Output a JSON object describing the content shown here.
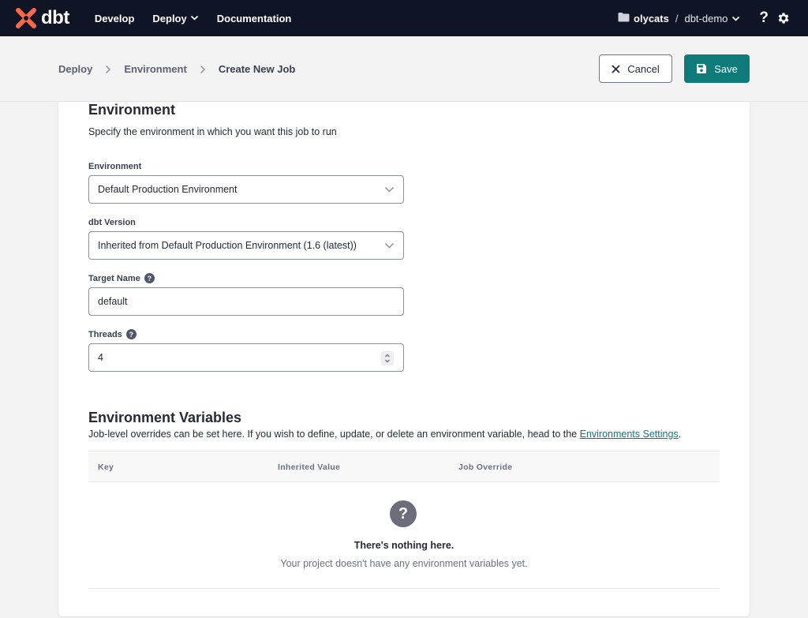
{
  "nav": {
    "logo_text": "dbt",
    "items": [
      {
        "label": "Develop"
      },
      {
        "label": "Deploy"
      },
      {
        "label": "Documentation"
      }
    ],
    "account": {
      "org": "olycats",
      "separator": "/",
      "project": "dbt-demo"
    },
    "help_label": "?",
    "brand_color": "#ff694a",
    "nav_bg": "#0f1525"
  },
  "breadcrumb": {
    "items": [
      "Deploy",
      "Environment",
      "Create New Job"
    ]
  },
  "actions": {
    "cancel_label": "Cancel",
    "save_label": "Save",
    "save_color": "#0f7a7a"
  },
  "environment": {
    "title": "Environment",
    "description": "Specify the environment in which you want this job to run",
    "env_label": "Environment",
    "env_value": "Default Production Environment",
    "version_label": "dbt Version",
    "version_value": "Inherited from Default Production Environment (1.6 (latest))",
    "target_label": "Target Name",
    "target_value": "default",
    "threads_label": "Threads",
    "threads_value": "4"
  },
  "env_vars": {
    "title": "Environment Variables",
    "description": "Job-level overrides can be set here. If you wish to define, update, or delete an environment variable, head to the ",
    "link_text": "Environments Settings",
    "description_end": ".",
    "columns": [
      "Key",
      "Inherited Value",
      "Job Override"
    ],
    "empty_icon": "?",
    "empty_title": "There's nothing here.",
    "empty_desc": "Your project doesn't have any environment variables yet."
  }
}
